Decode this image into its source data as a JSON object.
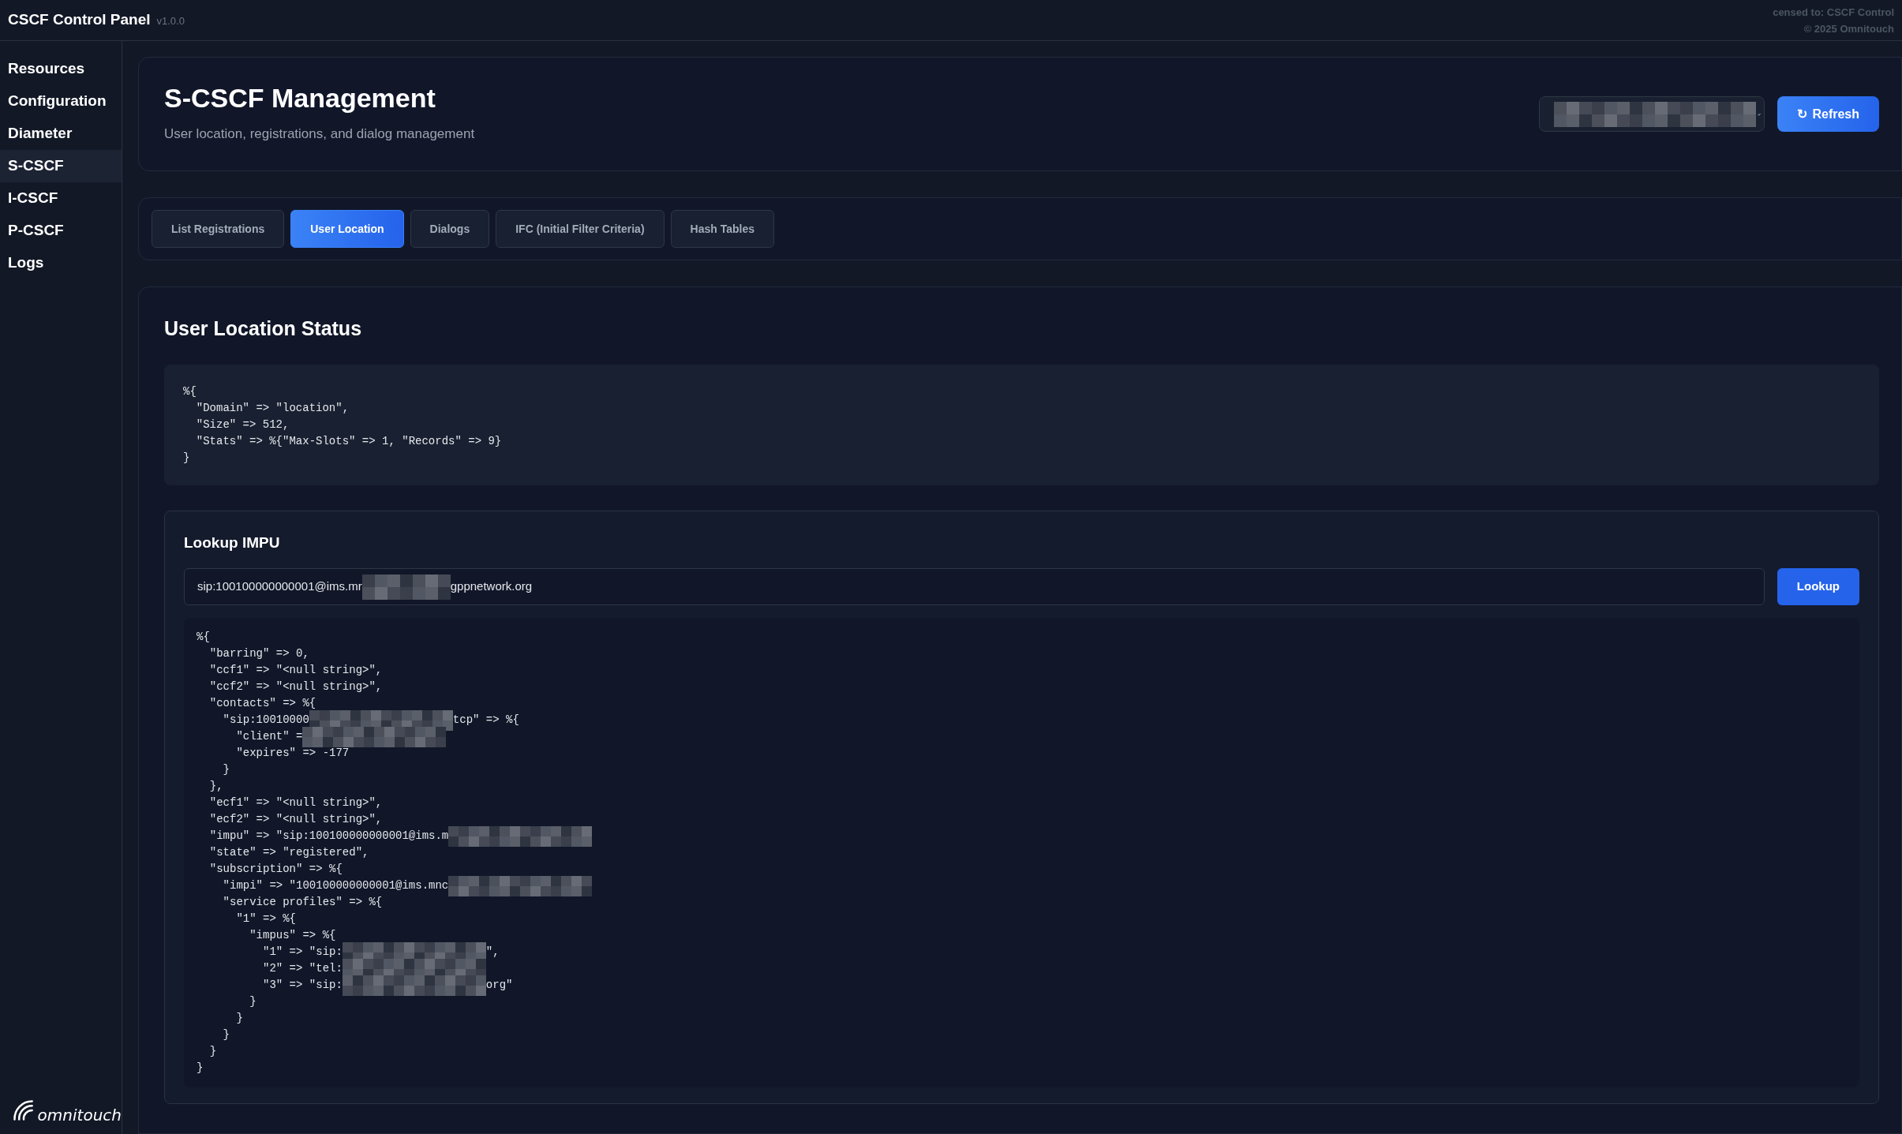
{
  "app": {
    "title": "CSCF Control Panel",
    "version": "v1.0.0",
    "license": "censed to: CSCF Control",
    "copyright": "© 2025 Omnitouch",
    "logo": "omnitouch"
  },
  "sidebar": {
    "items": [
      {
        "label": "Resources",
        "selected": false
      },
      {
        "label": "Configuration",
        "selected": false
      },
      {
        "label": "Diameter",
        "selected": false
      },
      {
        "label": "S-CSCF",
        "selected": true
      },
      {
        "label": "I-CSCF",
        "selected": false
      },
      {
        "label": "P-CSCF",
        "selected": false
      },
      {
        "label": "Logs",
        "selected": false
      }
    ]
  },
  "header": {
    "title": "S-CSCF Management",
    "subtitle": "User location, registrations, and dialog management",
    "host_select": {
      "redacted": true
    },
    "refresh_icon": "↻",
    "refresh_label": "Refresh"
  },
  "tabs": [
    {
      "label": "List Registrations",
      "selected": false
    },
    {
      "label": "User Location",
      "selected": true
    },
    {
      "label": "Dialogs",
      "selected": false
    },
    {
      "label": "IFC (Initial Filter Criteria)",
      "selected": false
    },
    {
      "label": "Hash Tables",
      "selected": false
    }
  ],
  "status": {
    "title": "User Location Status",
    "code": "%{\n  \"Domain\" => \"location\",\n  \"Size\" => 512,\n  \"Stats\" => %{\"Max-Slots\" => 1, \"Records\" => 9}\n}"
  },
  "lookup": {
    "title": "Lookup IMPU",
    "value_start": "sip:100100000000001@ims.mr",
    "value_end": "gppnetwork.org",
    "button": "Lookup",
    "result_lines": [
      [
        {
          "kind": "text",
          "text": "%{"
        }
      ],
      [
        {
          "kind": "text",
          "text": "  \"barring\" => 0,"
        }
      ],
      [
        {
          "kind": "text",
          "text": "  \"ccf1\" => \"<null string>\","
        }
      ],
      [
        {
          "kind": "text",
          "text": "  \"ccf2\" => \"<null string>\","
        }
      ],
      [
        {
          "kind": "text",
          "text": "  \"contacts\" => %{"
        }
      ],
      [
        {
          "kind": "text",
          "text": "    \"sip:10010000"
        },
        {
          "kind": "redacted"
        },
        {
          "kind": "text",
          "text": "tcp\" => %{"
        }
      ],
      [
        {
          "kind": "text",
          "text": "      \"client\" ="
        },
        {
          "kind": "redacted"
        }
      ],
      [
        {
          "kind": "text",
          "text": "      \"expires\" => -177"
        }
      ],
      [
        {
          "kind": "text",
          "text": "    }"
        }
      ],
      [
        {
          "kind": "text",
          "text": "  },"
        }
      ],
      [
        {
          "kind": "text",
          "text": "  \"ecf1\" => \"<null string>\","
        }
      ],
      [
        {
          "kind": "text",
          "text": "  \"ecf2\" => \"<null string>\","
        }
      ],
      [
        {
          "kind": "text",
          "text": "  \"impu\" => \"sip:100100000000001@ims.m"
        },
        {
          "kind": "redacted"
        }
      ],
      [
        {
          "kind": "text",
          "text": "  \"state\" => \"registered\","
        }
      ],
      [
        {
          "kind": "text",
          "text": "  \"subscription\" => %{"
        }
      ],
      [
        {
          "kind": "text",
          "text": "    \"impi\" => \"100100000000001@ims.mnc"
        },
        {
          "kind": "redacted"
        }
      ],
      [
        {
          "kind": "text",
          "text": "    \"service profiles\" => %{"
        }
      ],
      [
        {
          "kind": "text",
          "text": "      \"1\" => %{"
        }
      ],
      [
        {
          "kind": "text",
          "text": "        \"impus\" => %{"
        }
      ],
      [
        {
          "kind": "text",
          "text": "          \"1\" => \"sip:"
        },
        {
          "kind": "redacted"
        },
        {
          "kind": "text",
          "text": "\","
        }
      ],
      [
        {
          "kind": "text",
          "text": "          \"2\" => \"tel:"
        },
        {
          "kind": "redacted"
        }
      ],
      [
        {
          "kind": "text",
          "text": "          \"3\" => \"sip:"
        },
        {
          "kind": "redacted"
        },
        {
          "kind": "text",
          "text": "org\""
        }
      ],
      [
        {
          "kind": "text",
          "text": "        }"
        }
      ],
      [
        {
          "kind": "text",
          "text": "      }"
        }
      ],
      [
        {
          "kind": "text",
          "text": "    }"
        }
      ],
      [
        {
          "kind": "text",
          "text": "  }"
        }
      ],
      [
        {
          "kind": "text",
          "text": "}"
        }
      ]
    ]
  }
}
